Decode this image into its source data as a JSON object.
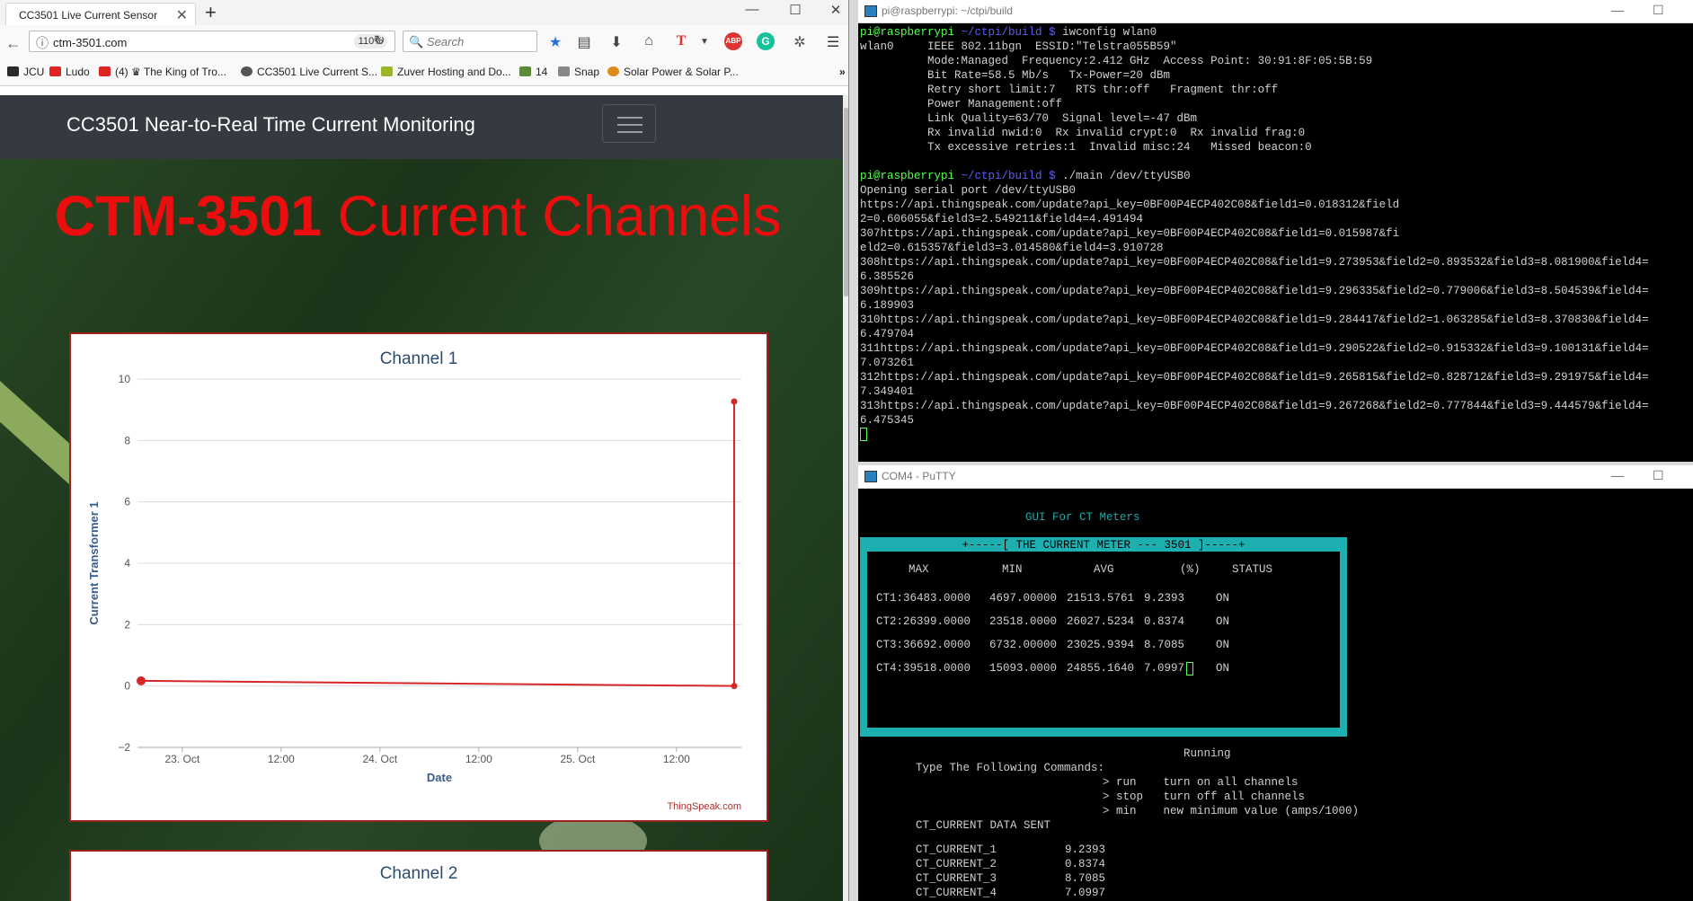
{
  "browser": {
    "tab_title": "CC3501 Live Current Sensor",
    "url": "ctm-3501.com",
    "zoom": "110%",
    "search_placeholder": "Search",
    "bookmarks": [
      {
        "label": "JCU",
        "color": "#2a2a2a"
      },
      {
        "label": "Ludo",
        "color": "#e02424"
      },
      {
        "label": "(4) ♛ The King of Tro...",
        "color": "#e02424"
      },
      {
        "label": "CC3501 Live Current S...",
        "color": "#555555"
      },
      {
        "label": "Zuver Hosting and Do...",
        "color": "#9ab72a"
      },
      {
        "label": "14",
        "color": "#5a8a3a"
      },
      {
        "label": "Snap",
        "color": "#888888"
      },
      {
        "label": "Solar Power & Solar P...",
        "color": "#e08a1e"
      }
    ]
  },
  "page": {
    "brand": "CC3501 Near-to-Real Time Current Monitoring",
    "heading_bold": "CTM-3501",
    "heading_rest": "Current Channels",
    "credit": "ThingSpeak.com",
    "accent_color": "#ec0e0e"
  },
  "chart_data": {
    "type": "line",
    "title": "Channel 1",
    "xlabel": "Date",
    "ylabel": "Current Transformer 1",
    "x_tick_labels": [
      "23. Oct",
      "12:00",
      "24. Oct",
      "12:00",
      "25. Oct",
      "12:00"
    ],
    "y_ticks": [
      -2,
      0,
      2,
      4,
      6,
      8,
      10
    ],
    "ylim": [
      -2,
      10
    ],
    "grid": true,
    "series": [
      {
        "color": "#d62728",
        "points": [
          {
            "x": "2017-10-22 19:00",
            "y": 0.17
          },
          {
            "x": "2017-10-25 19:00",
            "y": 0.0
          },
          {
            "x": "2017-10-25 19:00",
            "y": 9.27
          }
        ]
      }
    ]
  },
  "chart2_title": "Channel 2",
  "terminal1": {
    "title": "pi@raspberrypi: ~/ctpi/build",
    "prompt_user": "pi@raspberrypi",
    "prompt_path": "~/ctpi/build $",
    "cmd1": "iwconfig wlan0",
    "iw_lines": [
      "wlan0     IEEE 802.11bgn  ESSID:\"Telstra055B59\"",
      "          Mode:Managed  Frequency:2.412 GHz  Access Point: 30:91:8F:05:5B:59",
      "          Bit Rate=58.5 Mb/s   Tx-Power=20 dBm",
      "          Retry short limit:7   RTS thr:off   Fragment thr:off",
      "          Power Management:off",
      "          Link Quality=63/70  Signal level=-47 dBm",
      "          Rx invalid nwid:0  Rx invalid crypt:0  Rx invalid frag:0",
      "          Tx excessive retries:1  Invalid misc:24   Missed beacon:0"
    ],
    "cmd2": "./main /dev/ttyUSB0",
    "out_lines": [
      "Opening serial port /dev/ttyUSB0",
      "https://api.thingspeak.com/update?api_key=0BF00P4ECP402C08&field1=0.018312&field",
      "2=0.606055&field3=2.549211&field4=4.491494",
      "307https://api.thingspeak.com/update?api_key=0BF00P4ECP402C08&field1=0.015987&fi",
      "eld2=0.615357&field3=3.014580&field4=3.910728",
      "308https://api.thingspeak.com/update?api_key=0BF00P4ECP402C08&field1=9.273953&field2=0.893532&field3=8.081900&field4=",
      "6.385526",
      "309https://api.thingspeak.com/update?api_key=0BF00P4ECP402C08&field1=9.296335&field2=0.779006&field3=8.504539&field4=",
      "6.189903",
      "310https://api.thingspeak.com/update?api_key=0BF00P4ECP402C08&field1=9.284417&field2=1.063285&field3=8.370830&field4=",
      "6.479704",
      "311https://api.thingspeak.com/update?api_key=0BF00P4ECP402C08&field1=9.290522&field2=0.915332&field3=9.100131&field4=",
      "7.073261",
      "312https://api.thingspeak.com/update?api_key=0BF00P4ECP402C08&field1=9.265815&field2=0.828712&field3=9.291975&field4=",
      "7.349401",
      "313https://api.thingspeak.com/update?api_key=0BF00P4ECP402C08&field1=9.267268&field2=0.777844&field3=9.444579&field4=",
      "6.475345"
    ]
  },
  "terminal2": {
    "title": "COM4 - PuTTY",
    "gui_title": "GUI For CT Meters",
    "box_title": "+-----[ THE CURRENT METER --- 3501 ]-----+",
    "headers": [
      "MAX",
      "MIN",
      "AVG",
      "(%)",
      "STATUS"
    ],
    "rows": [
      {
        "label": "CT1:",
        "max": "36483.0000",
        "min": "4697.00000",
        "avg": "21513.5761",
        "pct": "9.2393",
        "status": "ON"
      },
      {
        "label": "CT2:",
        "max": "26399.0000",
        "min": "23518.0000",
        "avg": "26027.5234",
        "pct": "0.8374",
        "status": "ON"
      },
      {
        "label": "CT3:",
        "max": "36692.0000",
        "min": "6732.00000",
        "avg": "23025.9394",
        "pct": "8.7085",
        "status": "ON"
      },
      {
        "label": "CT4:",
        "max": "39518.0000",
        "min": "15093.0000",
        "avg": "24855.1640",
        "pct": "7.0997",
        "status": "ON"
      }
    ],
    "running": "Running",
    "commands_title": "Type The Following Commands:",
    "commands": [
      "> run    turn on all channels",
      "> stop   turn off all channels",
      "> min    new minimum value (amps/1000)"
    ],
    "sent_title": "CT_CURRENT DATA SENT",
    "sent": [
      {
        "name": "CT_CURRENT_1",
        "value": "9.2393"
      },
      {
        "name": "CT_CURRENT_2",
        "value": "0.8374"
      },
      {
        "name": "CT_CURRENT_3",
        "value": "8.7085"
      },
      {
        "name": "CT_CURRENT_4",
        "value": "7.0997"
      }
    ]
  }
}
